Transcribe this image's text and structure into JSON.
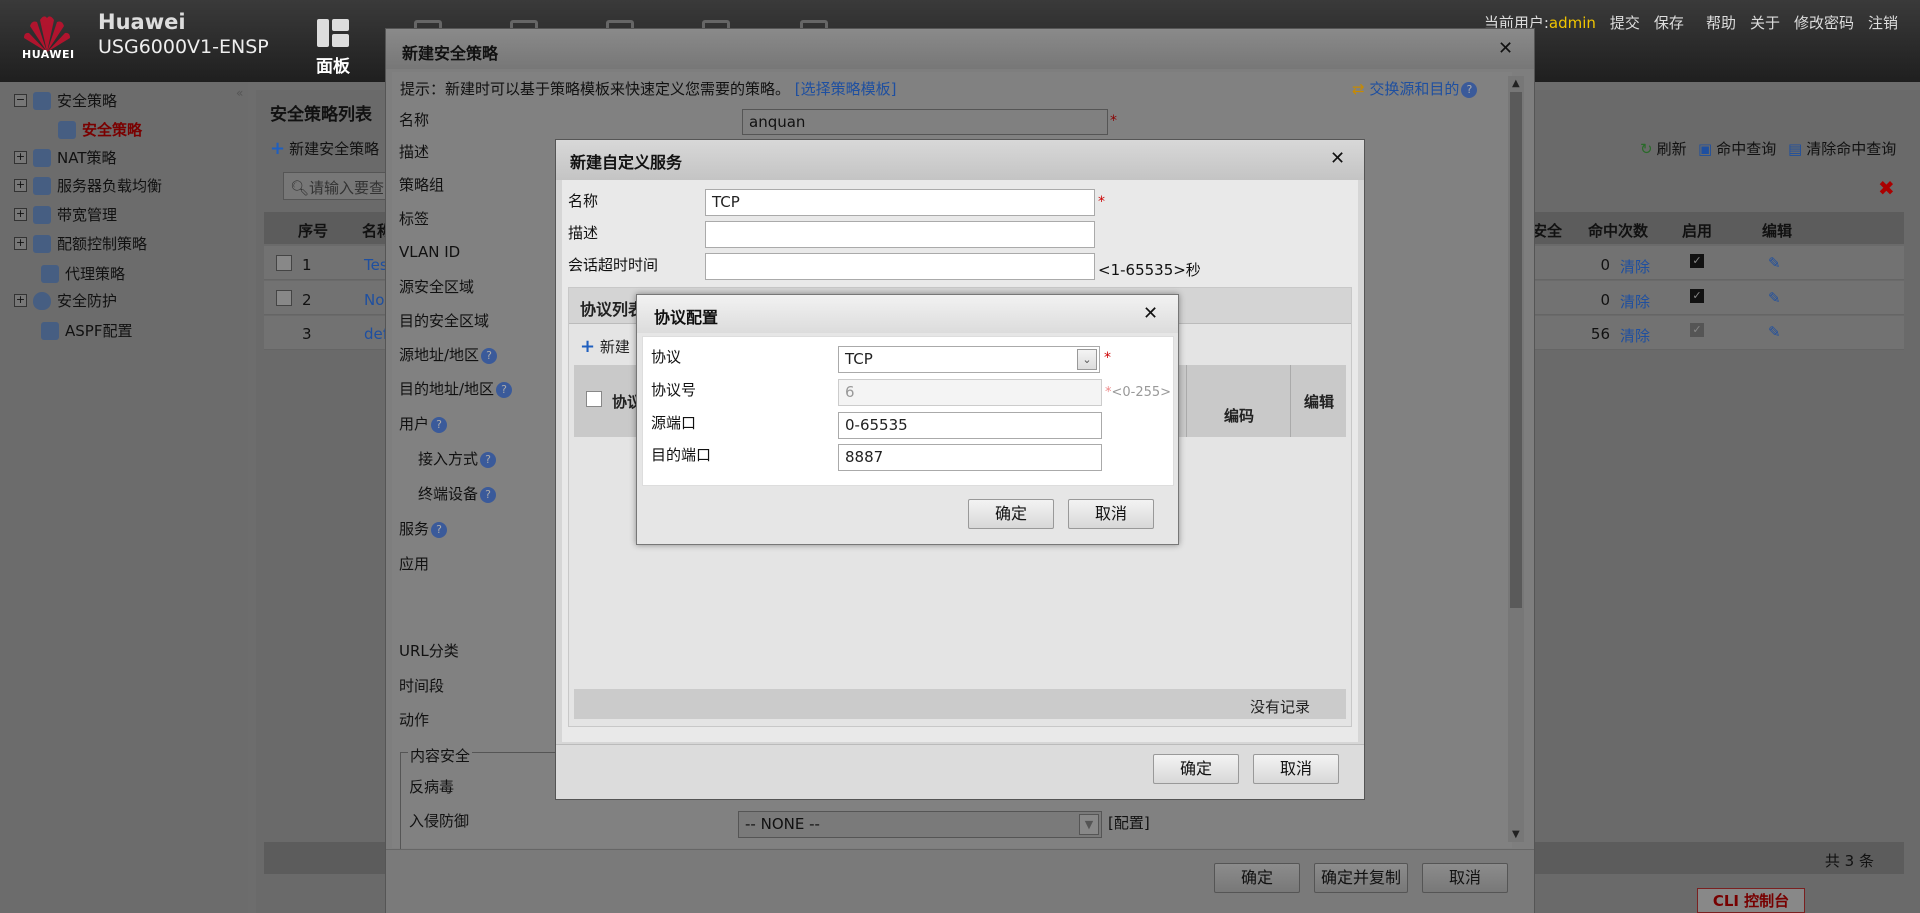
{
  "header": {
    "brand": "Huawei",
    "logo_text": "HUAWEI",
    "product": "USG6000V1-ENSP",
    "nav_active": "面板",
    "user_label": "当前用户:",
    "user_name": "admin",
    "links": [
      "提交",
      "保存",
      "帮助",
      "关于",
      "修改密码",
      "注销"
    ]
  },
  "tree": {
    "items": [
      {
        "label": "安全策略",
        "expanded": true
      },
      {
        "label": "安全策略",
        "selected": true
      },
      {
        "label": "NAT策略"
      },
      {
        "label": "服务器负载均衡"
      },
      {
        "label": "带宽管理"
      },
      {
        "label": "配额控制策略"
      },
      {
        "label": "代理策略"
      },
      {
        "label": "安全防护"
      },
      {
        "label": "ASPF配置"
      }
    ]
  },
  "list": {
    "title": "安全策略列表",
    "new_button": "新建安全策略",
    "search_placeholder": "请输入要查",
    "refresh": "刷新",
    "hit_query": "命中查询",
    "clear_hit_query": "清除命中查询",
    "headers": {
      "seq": "序号",
      "name": "名称",
      "security": "安全",
      "hits": "命中次数",
      "enabled": "启用",
      "edit": "编辑"
    },
    "rows": [
      {
        "seq": "1",
        "name": "Tes",
        "hits": "0",
        "clear": "清除",
        "enabled": true
      },
      {
        "seq": "2",
        "name": "No",
        "hits": "0",
        "clear": "清除",
        "enabled": true
      },
      {
        "seq": "3",
        "name": "def",
        "hits": "56",
        "clear": "清除",
        "enabled": true
      }
    ],
    "total": "共 3 条",
    "cli": "CLI 控制台"
  },
  "dialog_policy": {
    "title": "新建安全策略",
    "hint": "提示：新建时可以基于策略模板来快速定义您需要的策略。",
    "template_link": "[选择策略模板]",
    "swap": "交换源和目的",
    "labels": {
      "name": "名称",
      "desc": "描述",
      "group": "策略组",
      "tag": "标签",
      "vlan": "VLAN ID",
      "src_zone": "源安全区域",
      "dst_zone": "目的安全区域",
      "src_addr": "源地址/地区",
      "dst_addr": "目的地址/地区",
      "user": "用户",
      "access": "接入方式",
      "terminal": "终端设备",
      "service": "服务",
      "app": "应用",
      "url": "URL分类",
      "time": "时间段",
      "action": "动作",
      "content_sec": "内容安全",
      "antivirus": "反病毒",
      "ips": "入侵防御"
    },
    "name_value": "anquan",
    "ips_value": "-- NONE --",
    "ips_config": "[配置]",
    "buttons": {
      "ok": "确定",
      "ok_copy": "确定并复制",
      "cancel": "取消"
    }
  },
  "dialog_service": {
    "title": "新建自定义服务",
    "labels": {
      "name": "名称",
      "desc": "描述",
      "timeout": "会话超时时间"
    },
    "name_value": "TCP",
    "timeout_hint": "<1-65535>秒",
    "protocol_list_title": "协议列表",
    "new_button": "新建",
    "col_protocol": "协议",
    "col_code": "编码",
    "col_edit": "编辑",
    "no_records": "没有记录",
    "buttons": {
      "ok": "确定",
      "cancel": "取消"
    }
  },
  "dialog_protocol": {
    "title": "协议配置",
    "labels": {
      "protocol": "协议",
      "proto_num": "协议号",
      "src_port": "源端口",
      "dst_port": "目的端口"
    },
    "protocol_value": "TCP",
    "proto_num_value": "6",
    "proto_num_hint": "<0-255>",
    "src_port_value": "0-65535",
    "dst_port_value": "8887",
    "buttons": {
      "ok": "确定",
      "cancel": "取消"
    }
  },
  "colors": {
    "header_bg": "#2b2b2b",
    "user_name": "#f0c400",
    "link": "#1e4fa0",
    "required": "#cc0000"
  }
}
